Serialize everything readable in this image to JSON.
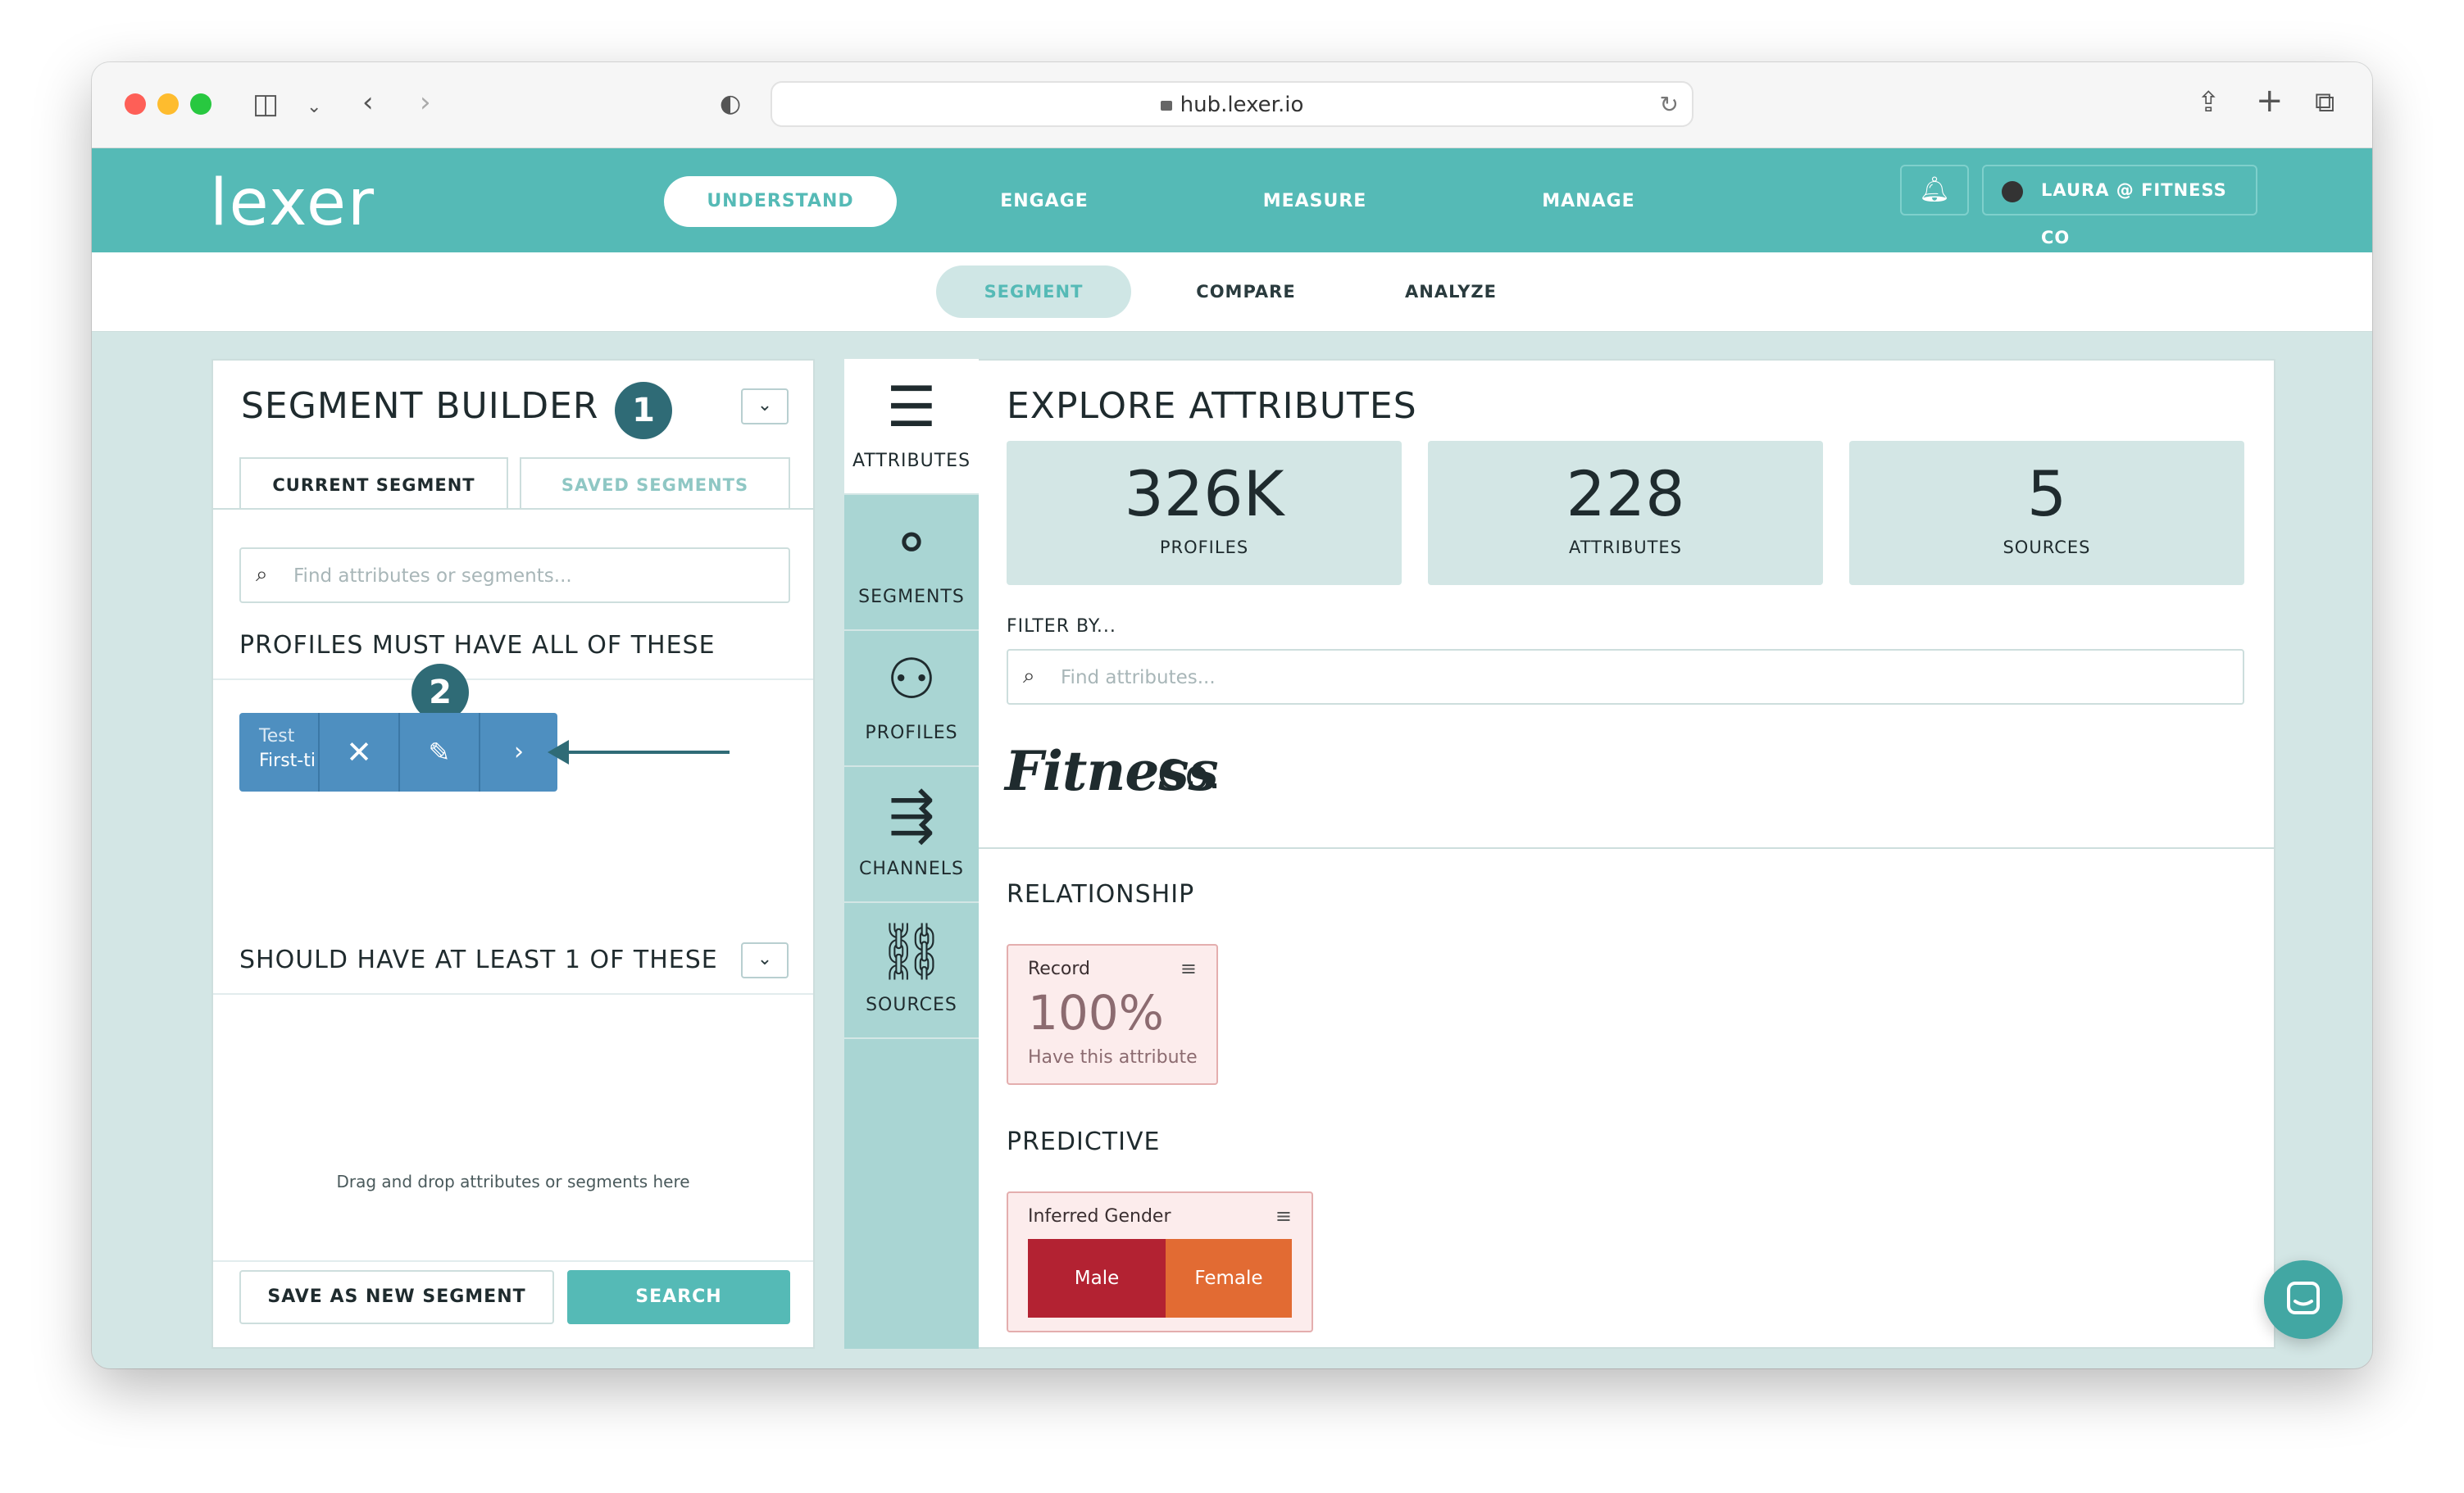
{
  "browser": {
    "url": "hub.lexer.io"
  },
  "app": {
    "logo": "lexer",
    "nav": [
      "UNDERSTAND",
      "ENGAGE",
      "MEASURE",
      "MANAGE"
    ],
    "user": "LAURA @ FITNESS CO",
    "subnav": [
      "SEGMENT",
      "COMPARE",
      "ANALYZE"
    ]
  },
  "segment_builder": {
    "title": "SEGMENT BUILDER",
    "step1": "1",
    "step2": "2",
    "tabs": [
      "CURRENT SEGMENT",
      "SAVED SEGMENTS"
    ],
    "search_placeholder": "Find attributes or segments...",
    "must_title": "PROFILES MUST HAVE ALL OF THESE",
    "pill_line1": "Test",
    "pill_line2": "First-ti",
    "should_title": "SHOULD HAVE AT LEAST 1 OF THESE",
    "drop_hint": "Drag and drop attributes or segments here",
    "save_button": "SAVE AS NEW SEGMENT",
    "search_button": "SEARCH"
  },
  "rail": [
    {
      "icon": "list-icon",
      "label": "ATTRIBUTES"
    },
    {
      "icon": "segments-icon",
      "label": "SEGMENTS"
    },
    {
      "icon": "person-icon",
      "label": "PROFILES"
    },
    {
      "icon": "channels-icon",
      "label": "CHANNELS"
    },
    {
      "icon": "sources-icon",
      "label": "SOURCES"
    }
  ],
  "explore": {
    "title": "EXPLORE ATTRIBUTES",
    "stats": [
      {
        "value": "326K",
        "label": "PROFILES"
      },
      {
        "value": "228",
        "label": "ATTRIBUTES"
      },
      {
        "value": "5",
        "label": "SOURCES"
      }
    ],
    "filter_label": "FILTER BY...",
    "filter_placeholder": "Find attributes...",
    "brand_script": "Fitness",
    "brand_rest": "Co.",
    "relationship_title": "RELATIONSHIP",
    "record_card": {
      "title": "Record",
      "value": "100%",
      "sub": "Have this attribute"
    },
    "predictive_title": "PREDICTIVE",
    "gender_card": {
      "title": "Inferred Gender",
      "male": "Male",
      "female": "Female"
    }
  },
  "colors": {
    "teal": "#55bab6",
    "dark_teal": "#2f6b76",
    "male": "#b32232",
    "female": "#e26b33",
    "pill": "#4e8fc0"
  }
}
